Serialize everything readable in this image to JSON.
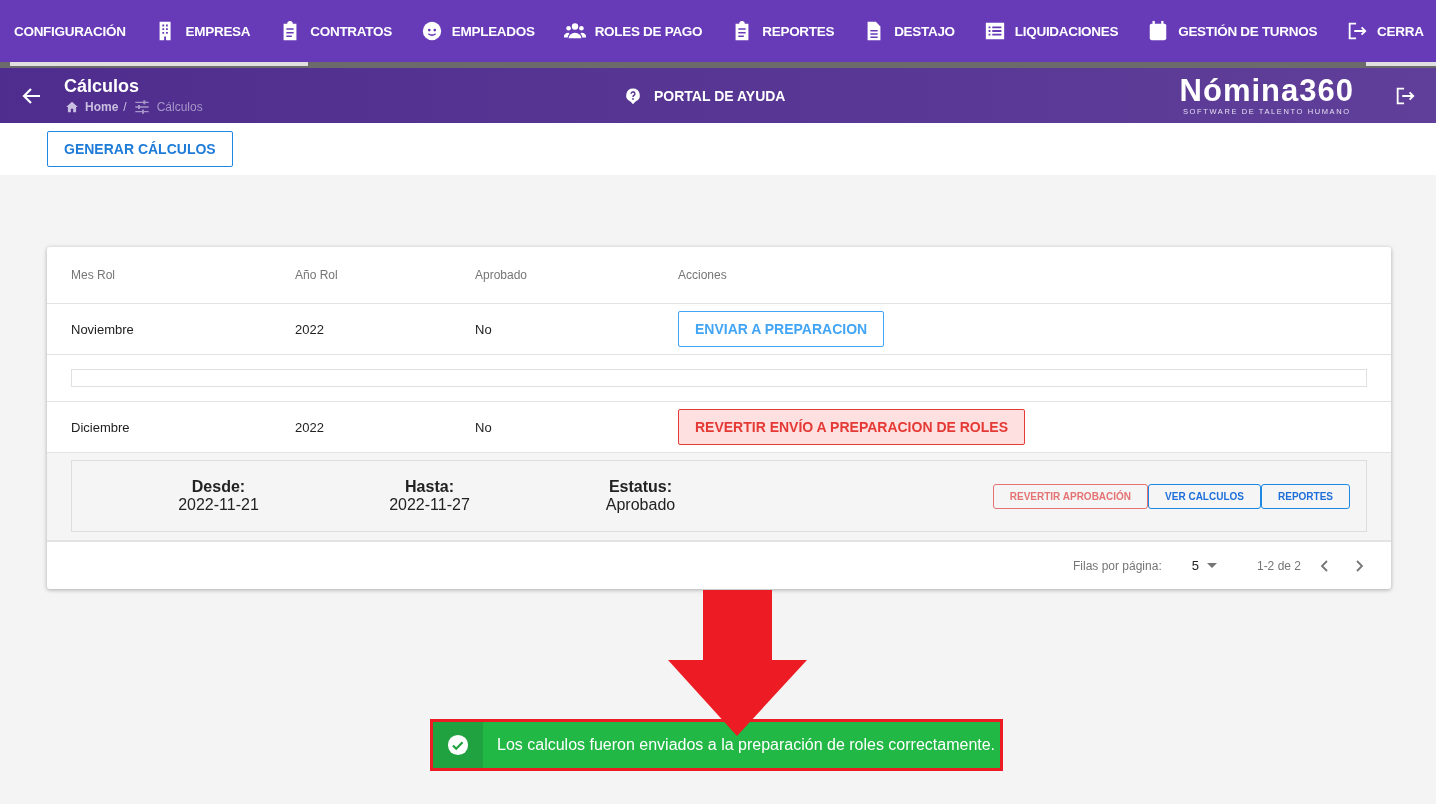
{
  "nav": {
    "tabs": [
      {
        "label": "CONFIGURACIÓN",
        "kind": "none"
      },
      {
        "label": "EMPRESA",
        "kind": "building"
      },
      {
        "label": "CONTRATOS",
        "kind": "clipboard"
      },
      {
        "label": "EMPLEADOS",
        "kind": "face"
      },
      {
        "label": "ROLES DE PAGO",
        "kind": "people"
      },
      {
        "label": "REPORTES",
        "kind": "clipboard"
      },
      {
        "label": "DESTAJO",
        "kind": "document"
      },
      {
        "label": "LIQUIDACIONES",
        "kind": "list"
      },
      {
        "label": "GESTIÓN DE TURNOS",
        "kind": "calendar"
      },
      {
        "label": "CERRA",
        "kind": "exit"
      }
    ]
  },
  "header": {
    "title": "Cálculos",
    "breadcrumb": [
      "Home",
      "Cálculos"
    ],
    "separator": "/",
    "help": "PORTAL DE AYUDA",
    "logo": "Nómina360",
    "tagline": "SOFTWARE DE TALENTO HUMANO"
  },
  "toolbar": {
    "button": "GENERAR CÁLCULOS"
  },
  "table": {
    "columns": [
      "Mes Rol",
      "Año Rol",
      "Aprobado",
      "Acciones"
    ],
    "rows": [
      {
        "cells": [
          "Noviembre",
          "2022",
          "No"
        ],
        "action": {
          "label": "ENVIAR A PREPARACION",
          "kind": "send"
        },
        "expanded": true
      },
      {
        "cells": [
          "Diciembre",
          "2022",
          "No"
        ],
        "action": {
          "label": "REVERTIR ENVÍO A PREPARACION DE ROLES",
          "kind": "revert"
        },
        "expanded": true,
        "details": {
          "fields": [
            {
              "label": "Desde:",
              "value": "2022-11-21"
            },
            {
              "label": "Hasta:",
              "value": "2022-11-27"
            },
            {
              "label": "Estatus:",
              "value": "Aprobado"
            }
          ],
          "buttons": [
            {
              "label": "REVERTIR APROBACIÓN",
              "kind": "danger"
            },
            {
              "label": "VER CALCULOS",
              "kind": "primary"
            },
            {
              "label": "REPORTES",
              "kind": "primary"
            }
          ]
        }
      }
    ]
  },
  "pagination": {
    "rows_label": "Filas por página:",
    "rows_per_page": "5",
    "range": "1-2 de 2"
  },
  "toast": {
    "message": "Los calculos fueron enviados a la preparación de roles correctamente."
  }
}
